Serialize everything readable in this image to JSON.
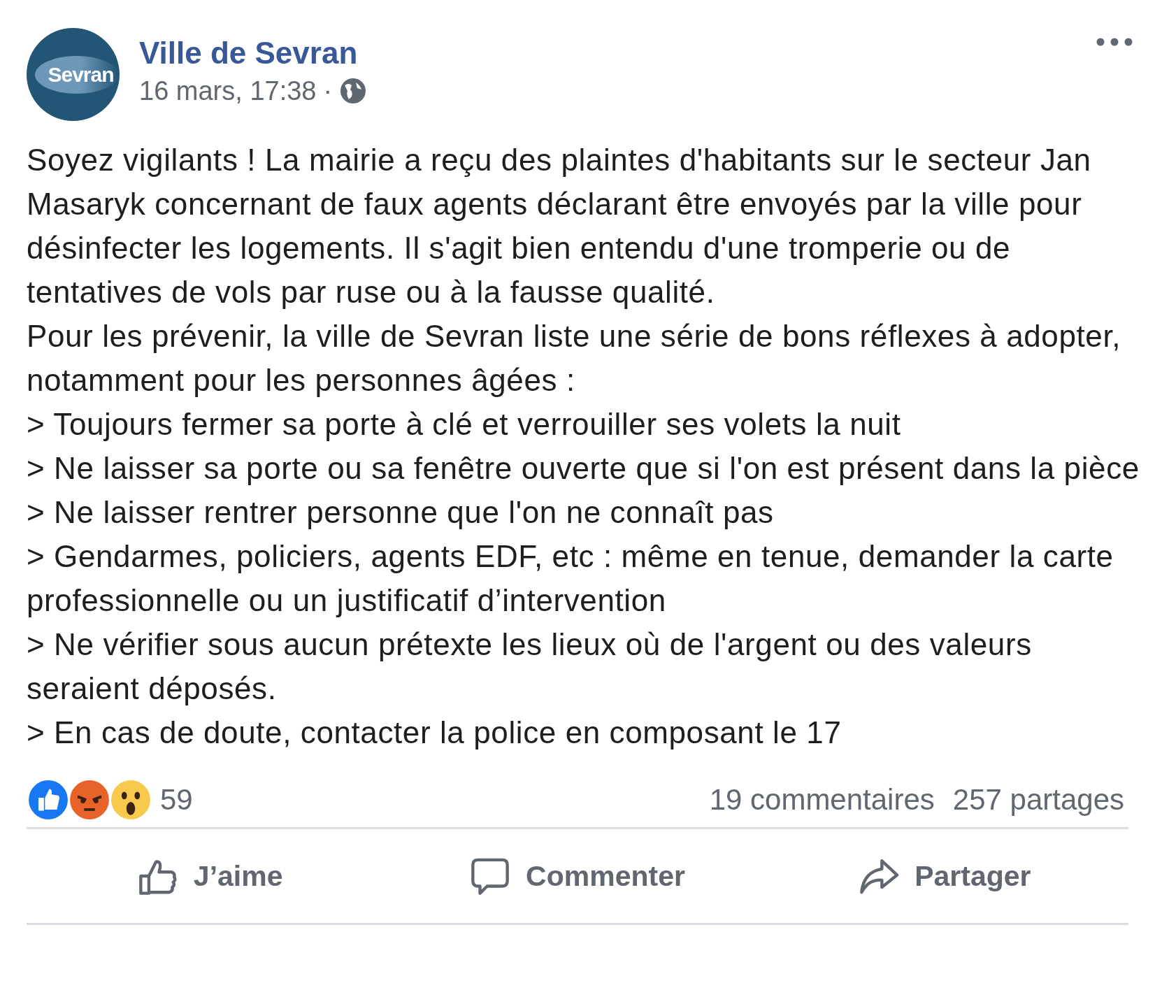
{
  "post": {
    "author": "Ville de Sevran",
    "avatar_text": "Sevran",
    "timestamp": "16 mars, 17:38",
    "separator": "·",
    "paragraphs": [
      "Soyez vigilants ! La mairie a reçu des plaintes d'habitants sur le secteur Jan Masaryk concernant de faux agents déclarant être envoyés par la ville pour désinfecter les logements. Il s'agit bien entendu d'une tromperie ou de tentatives de vols par ruse ou à la fausse qualité.",
      "Pour les prévenir, la ville de Sevran liste une série de bons réflexes à adopter, notamment pour les personnes âgées :",
      "> Toujours fermer sa porte à clé et verrouiller ses volets la nuit",
      "> Ne laisser sa porte ou sa fenêtre ouverte que si l'on est présent dans la pièce",
      "> Ne laisser rentrer personne que l'on ne connaît pas",
      "> Gendarmes, policiers, agents EDF, etc : même en tenue, demander la carte professionnelle ou un justificatif d’intervention",
      "> Ne vérifier sous aucun prétexte les lieux où de l'argent ou des valeurs seraient déposés.",
      "> En cas de doute, contacter la police en composant le 17"
    ]
  },
  "reactions": {
    "items": [
      {
        "kind": "like"
      },
      {
        "kind": "angry"
      },
      {
        "kind": "wow"
      }
    ],
    "count": "59"
  },
  "stats": {
    "comments": "19 commentaires",
    "shares": "257 partages"
  },
  "actions": [
    {
      "kind": "like",
      "label": "J’aime"
    },
    {
      "kind": "comment",
      "label": "Commenter"
    },
    {
      "kind": "share",
      "label": "Partager"
    }
  ]
}
